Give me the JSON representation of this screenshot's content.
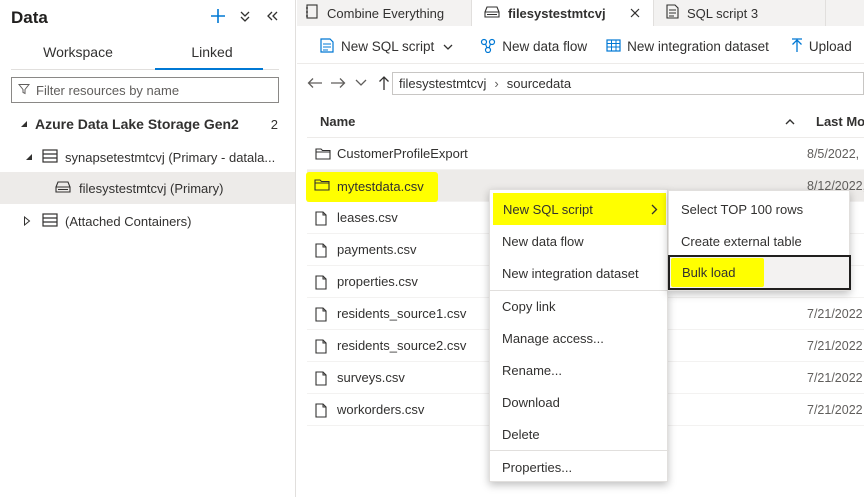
{
  "left_panel": {
    "title": "Data",
    "tabs": [
      "Workspace",
      "Linked"
    ],
    "active_tab": "Linked",
    "filter_placeholder": "Filter resources by name",
    "tree": {
      "section_title": "Azure Data Lake Storage Gen2",
      "section_count": "2",
      "account": "synapsetestmtcvj (Primary - datala...",
      "filesystem": "filesystestmtcvj (Primary)",
      "attached": "(Attached Containers)"
    },
    "icons": [
      "plus-icon",
      "chevron-down-double-icon",
      "collapse-left-icon",
      "filter-icon"
    ]
  },
  "editor_tabs": [
    {
      "label": "Combine Everything",
      "icon": "notebook-icon"
    },
    {
      "label": "filesystestmtcvj",
      "icon": "filesystem-icon",
      "active": true
    },
    {
      "label": "SQL script 3",
      "icon": "sql-script-icon"
    }
  ],
  "toolbar": {
    "new_sql_script": "New SQL script",
    "new_data_flow": "New data flow",
    "new_integration_dataset": "New integration dataset",
    "upload": "Upload"
  },
  "breadcrumb": {
    "root": "filesystestmtcvj",
    "folder": "sourcedata",
    "separator": "›"
  },
  "list": {
    "col_name": "Name",
    "col_modified": "Last Mod",
    "rows": [
      {
        "name": "CustomerProfileExport",
        "type": "folder",
        "date": "8/5/2022,"
      },
      {
        "name": "mytestdata.csv",
        "type": "folder",
        "date": "8/12/2022,"
      },
      {
        "name": "leases.csv",
        "type": "file",
        "date": ""
      },
      {
        "name": "payments.csv",
        "type": "file",
        "date": ""
      },
      {
        "name": "properties.csv",
        "type": "file",
        "date": ""
      },
      {
        "name": "residents_source1.csv",
        "type": "file",
        "date": "7/21/2022"
      },
      {
        "name": "residents_source2.csv",
        "type": "file",
        "date": "7/21/2022"
      },
      {
        "name": "surveys.csv",
        "type": "file",
        "date": "7/21/2022"
      },
      {
        "name": "workorders.csv",
        "type": "file",
        "date": "7/21/2022"
      }
    ]
  },
  "context_menu": {
    "items": [
      "New SQL script",
      "New data flow",
      "New integration dataset",
      "Copy link",
      "Manage access...",
      "Rename...",
      "Download",
      "Delete",
      "Properties..."
    ]
  },
  "submenu": {
    "items": [
      "Select TOP 100 rows",
      "Create external table",
      "Bulk load"
    ]
  },
  "colors": {
    "accent": "#0078d4",
    "highlight": "#ffff00",
    "selected_row": "#edebe9",
    "tab_bar": "#f3f2f1"
  }
}
